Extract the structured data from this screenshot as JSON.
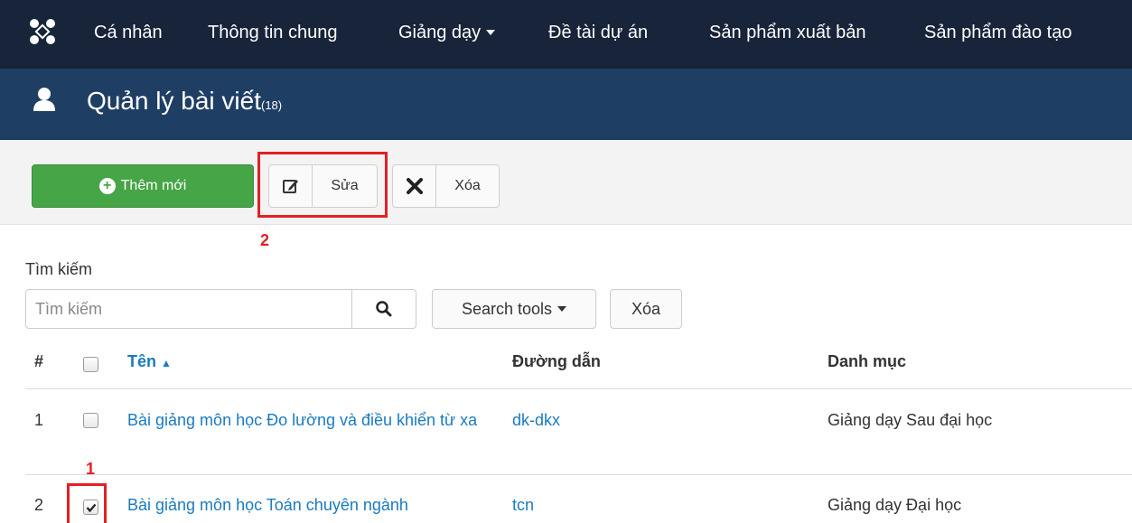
{
  "nav": {
    "logo": "joomla-logo",
    "items": [
      "Cá nhân",
      "Thông tin chung",
      "Giảng dạy",
      "Đề tài dự án",
      "Sản phẩm xuất bản",
      "Sản phẩm đào tạo"
    ]
  },
  "header": {
    "icon": "user-icon",
    "title": "Quản lý bài viết",
    "count": "(18)"
  },
  "toolbar": {
    "add_label": "Thêm mới",
    "edit_label": "Sửa",
    "delete_label": "Xóa"
  },
  "annotations": {
    "step1": "1",
    "step2": "2"
  },
  "search": {
    "label": "Tìm kiếm",
    "placeholder": "Tìm kiếm",
    "value": "",
    "tools_label": "Search tools",
    "clear_label": "Xóa"
  },
  "table": {
    "columns": [
      "#",
      "Tên",
      "Đường dẫn",
      "Danh mục"
    ],
    "rows": [
      {
        "num": "1",
        "title": "Bài giảng môn học Đo lường và điều khiển từ xa",
        "alias": "dk-dkx",
        "category": "Giảng dạy Sau đại học",
        "checked": false
      },
      {
        "num": "2",
        "title": "Bài giảng môn học Toán chuyên ngành",
        "alias": "tcn",
        "category": "Giảng dạy Đại học",
        "checked": true
      }
    ]
  },
  "colors": {
    "navbar": "#17243a",
    "header": "#1f3e64",
    "add_button": "#46a546",
    "link": "#1a7bc0",
    "annotation": "#e41f26"
  }
}
